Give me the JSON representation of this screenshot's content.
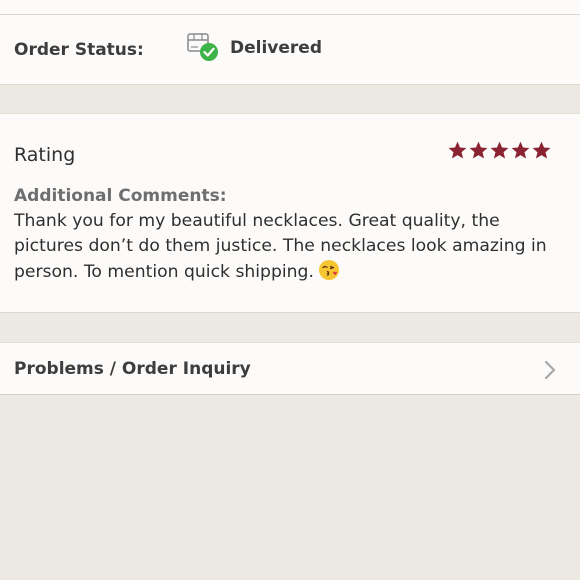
{
  "order_status": {
    "label": "Order Status:",
    "value": "Delivered",
    "icon": "delivered-box-icon",
    "icon_color": "#3db34a"
  },
  "rating": {
    "title": "Rating",
    "stars": 5,
    "max_stars": 5,
    "star_color": "#8a2432"
  },
  "comments": {
    "label": "Additional Comments:",
    "text": "Thank you for my beautiful necklaces. Great quality, the pictures don’t do them justice. The necklaces look amazing in person. To mention quick shipping.",
    "emoji": "😘"
  },
  "inquiry": {
    "label": "Problems / Order Inquiry",
    "icon": "chevron-right-icon"
  }
}
